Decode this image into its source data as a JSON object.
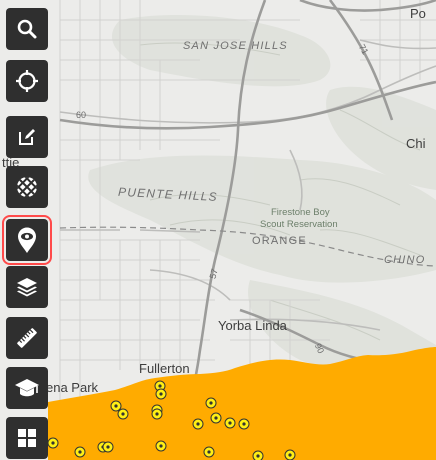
{
  "map": {
    "labels": {
      "san_jose_hills": "SAN JOSE HILLS",
      "puente_hills": "PUENTE HILLS",
      "orange": "ORANGE",
      "chino": "CHINO",
      "firestone_line1": "Firestone Boy",
      "firestone_line2": "Scout Reservation",
      "yorba_linda": "Yorba Linda",
      "fullerton": "Fullerton",
      "buena_park_partial": "ena Park",
      "po_partial": "Po",
      "chi_partial": "Chi",
      "left_edge_partial": "ttie"
    },
    "highway_shields": {
      "hwy_60": "60",
      "hwy_57": "57",
      "hwy_71": "71",
      "hwy_90": "90"
    },
    "colors": {
      "base": "#ececea",
      "overlay_area": "#ffab00",
      "point_marker": "#ffef14",
      "point_marker_outline": "#333333"
    },
    "point_markers_count": 19
  },
  "toolbar": {
    "tools": [
      {
        "name": "search-button",
        "icon": "search-icon",
        "selected": false
      },
      {
        "name": "locate-button",
        "icon": "crosshair-icon",
        "selected": false
      },
      {
        "name": "edit-button",
        "icon": "edit-icon",
        "selected": false
      },
      {
        "name": "basemap-button",
        "icon": "basemap-grid-icon",
        "selected": false
      },
      {
        "name": "view-location-button",
        "icon": "eye-pin-icon",
        "selected": true
      },
      {
        "name": "layers-button",
        "icon": "layers-icon",
        "selected": false
      },
      {
        "name": "measure-button",
        "icon": "ruler-icon",
        "selected": false
      },
      {
        "name": "education-button",
        "icon": "graduation-cap-icon",
        "selected": false
      },
      {
        "name": "apps-button",
        "icon": "grid-icon",
        "selected": false
      }
    ],
    "selected_outline_color": "#ff4a4a"
  }
}
